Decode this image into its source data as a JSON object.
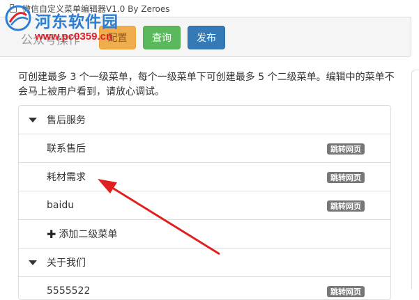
{
  "window": {
    "title": "微信自定义菜单编辑器V1.0 By Zeroes"
  },
  "toolbar": {
    "label": "公众号操作",
    "config_label": "配置",
    "query_label": "查询",
    "publish_label": "发布"
  },
  "watermark": {
    "title": "河东软件园",
    "url": "www.pc0359.cn"
  },
  "description": "可创建最多 3 个一级菜单，每个一级菜单下可创建最多 5 个二级菜单。编辑中的菜单不会马上被用户看到，请放心调试。",
  "menu": {
    "groups": [
      {
        "title": "售后服务",
        "items": [
          {
            "label": "联系售后",
            "badge": "跳转网页"
          },
          {
            "label": "耗材需求",
            "badge": "跳转网页"
          },
          {
            "label": "baidu",
            "badge": "跳转网页"
          }
        ],
        "add_label": "添加二级菜单"
      },
      {
        "title": "关于我们",
        "items": [
          {
            "label": "5555522",
            "badge": "跳转网页"
          }
        ]
      }
    ]
  },
  "colors": {
    "config_button": "#f0ad4e",
    "query_button": "#5cb85c",
    "publish_button": "#337ab7",
    "badge": "#777777",
    "annotation_arrow": "#e02020"
  },
  "icons": {
    "window_icon": "document-icon",
    "group_toggle": "caret-down-icon",
    "add": "plus-icon"
  }
}
